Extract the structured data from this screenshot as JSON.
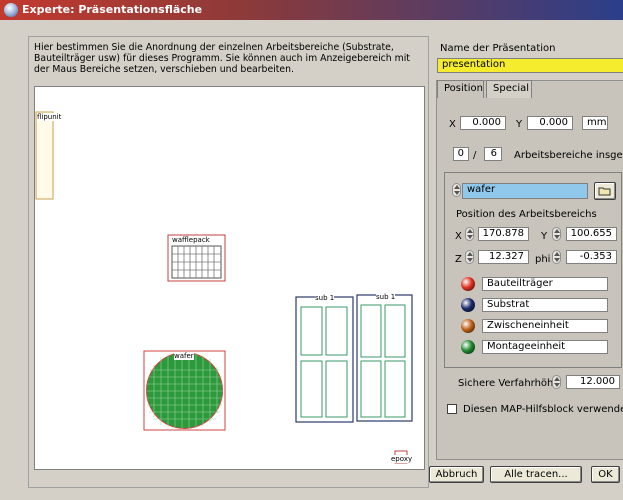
{
  "window": {
    "title": "Experte: Präsentationsfläche"
  },
  "description": "Hier bestimmen Sie die Anordnung der einzelnen Arbeitsbereiche (Substrate, Bauteilträger usw) für dieses Programm. Sie können auch im Anzeigebereich mit der Maus Bereiche setzen, verschieben und bearbeiten.",
  "canvas": {
    "labels": {
      "flipunit": "flipunit",
      "wafflepack": "wafflepack",
      "wafer": "wafer",
      "sub1a": "sub 1",
      "sub1b": "sub 1",
      "epoxy": "epoxy"
    }
  },
  "presentation": {
    "name_label": "Name der Präsentation",
    "name_value": "presentation"
  },
  "tabs": [
    "Position",
    "Special"
  ],
  "position": {
    "x_label": "X",
    "x_value": "0.000",
    "y_label": "Y",
    "y_value": "0.000",
    "unit": "mm",
    "count_current": "0",
    "count_sep": "/",
    "count_total": "6",
    "count_label": "Arbeitsbereiche insgesamt"
  },
  "area": {
    "selected": "wafer",
    "pos_label": "Position des Arbeitsbereichs",
    "x_label": "X",
    "x_value": "170.878",
    "y_label": "Y",
    "y_value": "100.655",
    "z_label": "Z",
    "z_value": "12.327",
    "phi_label": "phi",
    "phi_value": "-0.353",
    "types": [
      {
        "label": "Bauteilträger",
        "color": "#e03020"
      },
      {
        "label": "Substrat",
        "color": "#1a2a6a"
      },
      {
        "label": "Zwischeneinheit",
        "color": "#c06018"
      },
      {
        "label": "Montageeinheit",
        "color": "#208a30"
      }
    ]
  },
  "safe_height": {
    "label": "Sichere Verfahrhöhe",
    "value": "12.000"
  },
  "map_checkbox": {
    "label": "Diesen MAP-Hilfsblock verwenden",
    "checked": false
  },
  "buttons": {
    "abort": "Abbruch",
    "trace_all": "Alle tracen...",
    "ok": "OK"
  },
  "icons": {
    "title": "app-icon",
    "folder": "folder-icon"
  }
}
